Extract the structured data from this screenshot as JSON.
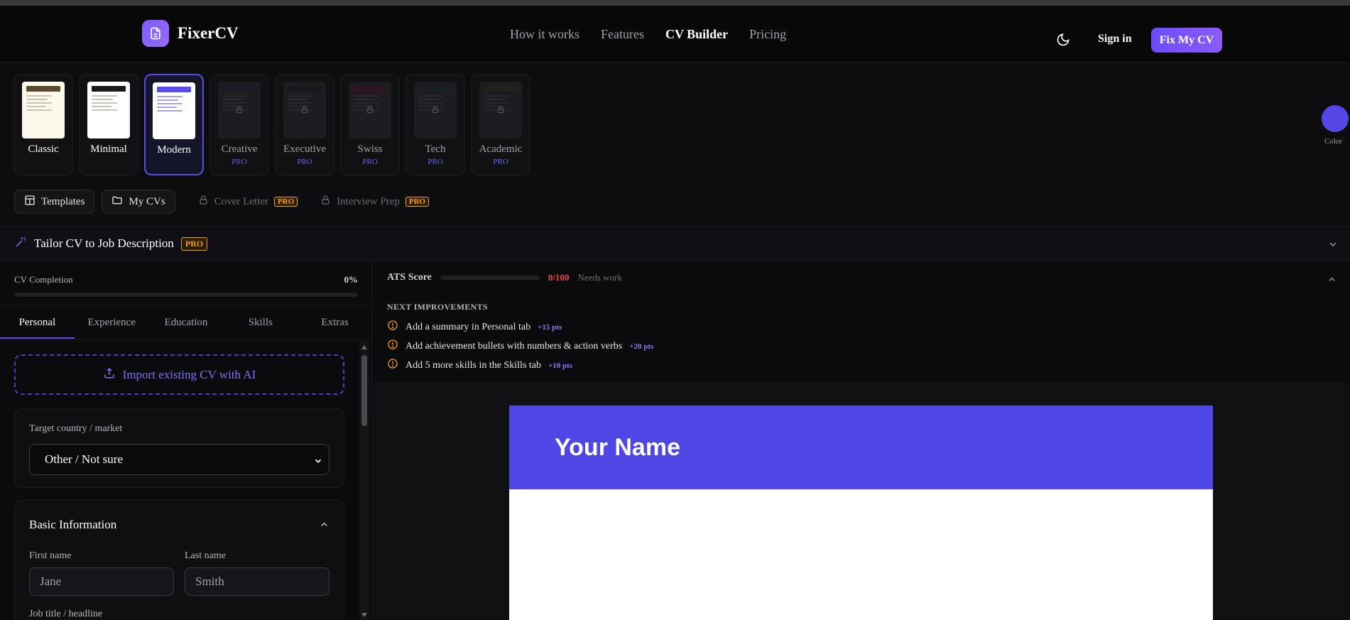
{
  "nav": {
    "brand": "FixerCV",
    "links": [
      "How it works",
      "Features",
      "CV Builder",
      "Pricing"
    ],
    "active_link": "CV Builder",
    "sign_in": "Sign in",
    "cta": "Fix My CV"
  },
  "templates": [
    {
      "name": "Classic",
      "pro": "",
      "locked": false,
      "accent": "#5b4a2e"
    },
    {
      "name": "Minimal",
      "pro": "",
      "locked": false,
      "accent": "#1a1a1a"
    },
    {
      "name": "Modern",
      "pro": "",
      "locked": false,
      "accent": "#5b4ee8",
      "selected": true
    },
    {
      "name": "Creative",
      "pro": "PRO",
      "locked": true,
      "accent": "#2a2744"
    },
    {
      "name": "Executive",
      "pro": "PRO",
      "locked": true,
      "accent": "#1f1f22"
    },
    {
      "name": "Swiss",
      "pro": "PRO",
      "locked": true,
      "accent": "#5c1a25"
    },
    {
      "name": "Tech",
      "pro": "PRO",
      "locked": true,
      "accent": "#243042"
    },
    {
      "name": "Academic",
      "pro": "PRO",
      "locked": true,
      "accent": "#3a3420"
    }
  ],
  "color_picker": {
    "label": "Color",
    "value": "#5447e6"
  },
  "toolbar": {
    "templates": "Templates",
    "my_cvs": "My CVs",
    "cover_letter": "Cover Letter",
    "interview_prep": "Interview Prep",
    "pro_badge": "PRO"
  },
  "tailor": {
    "title": "Tailor CV to Job Description",
    "badge": "PRO"
  },
  "completion": {
    "label": "CV Completion",
    "value": "0%",
    "fraction": 0
  },
  "tabs": [
    "Personal",
    "Experience",
    "Education",
    "Skills",
    "Extras"
  ],
  "active_tab": "Personal",
  "import": {
    "label": "Import existing CV with AI"
  },
  "country": {
    "label": "Target country / market",
    "value": "Other / Not sure"
  },
  "basic": {
    "title": "Basic Information",
    "first_label": "First name",
    "first_placeholder": "Jane",
    "last_label": "Last name",
    "last_placeholder": "Smith",
    "job_label": "Job title / headline"
  },
  "ats": {
    "title": "ATS Score",
    "score": "0/100",
    "status": "Needs work",
    "fraction": 0,
    "improvements_title": "NEXT IMPROVEMENTS",
    "improvements": [
      {
        "text": "Add a summary in Personal tab",
        "pts": "+15 pts"
      },
      {
        "text": "Add achievement bullets with numbers & action verbs",
        "pts": "+20 pts"
      },
      {
        "text": "Add 5 more skills in the Skills tab",
        "pts": "+10 pts"
      }
    ]
  },
  "preview": {
    "name": "Your Name"
  }
}
